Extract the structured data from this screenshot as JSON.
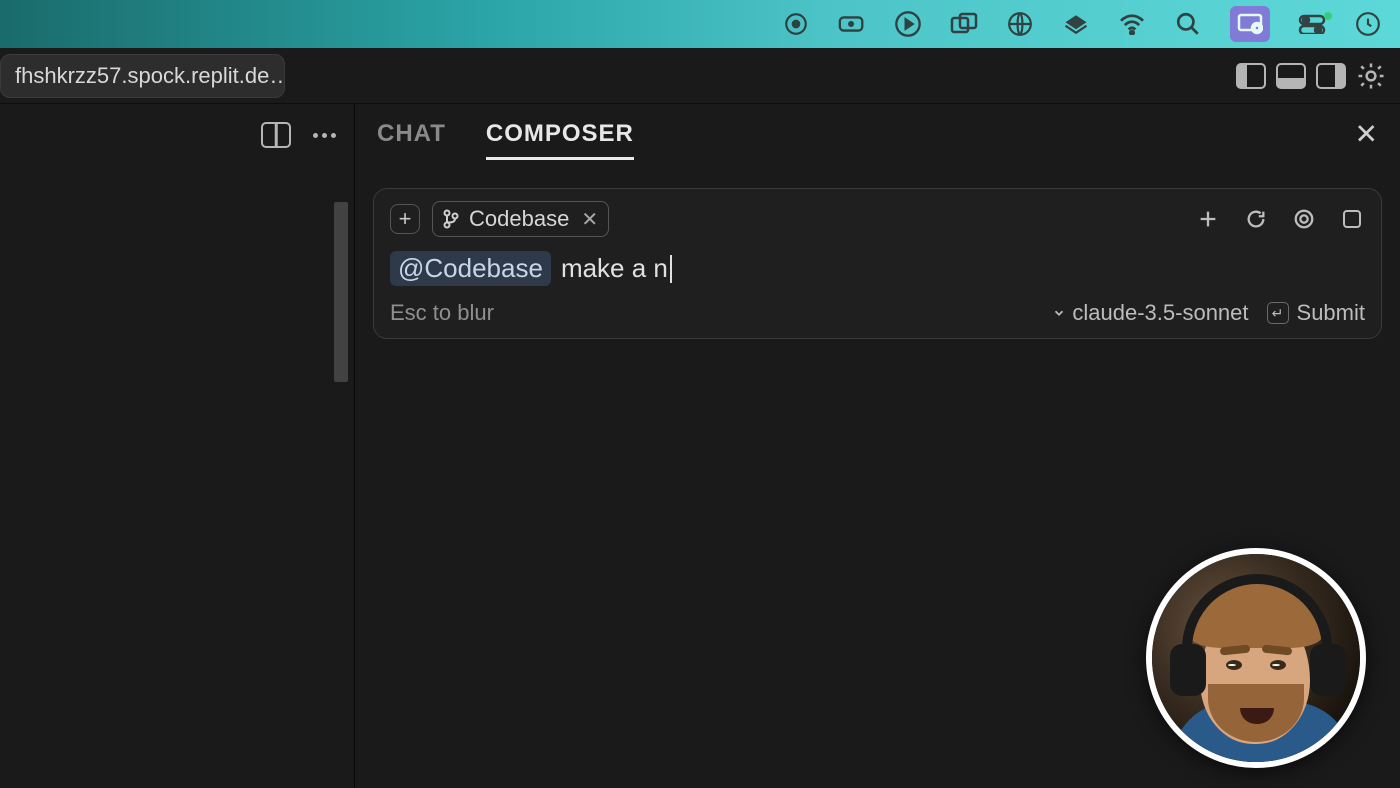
{
  "menubar": {
    "icons": [
      "record-target",
      "battery-rect",
      "play-circle",
      "overlap-windows",
      "globe-grid",
      "diamond-stack",
      "wifi",
      "search",
      "screen-share",
      "control-center",
      "clock"
    ]
  },
  "tab": {
    "title": "fhshkrzz57.spock.replit.de…"
  },
  "editor_right_controls": [
    "panel-left",
    "panel-bottom",
    "panel-right",
    "settings-gear"
  ],
  "sidebar": {
    "controls": [
      "split-view",
      "more-dots"
    ]
  },
  "panel": {
    "tabs": [
      {
        "label": "CHAT",
        "active": false
      },
      {
        "label": "COMPOSER",
        "active": true
      }
    ]
  },
  "composer": {
    "context_chip": {
      "icon": "git-branch",
      "label": "Codebase"
    },
    "mention": "@Codebase",
    "typed_text": " make a n",
    "hint": "Esc to blur",
    "model": "claude-3.5-sonnet",
    "submit_label": "Submit",
    "top_right_icons": [
      "plus",
      "refresh",
      "target",
      "stop"
    ]
  }
}
